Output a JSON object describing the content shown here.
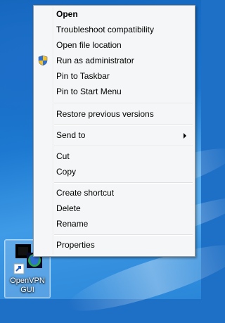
{
  "context_menu": {
    "items": [
      {
        "label": "Open"
      },
      {
        "label": "Troubleshoot compatibility"
      },
      {
        "label": "Open file location"
      },
      {
        "label": "Run as administrator",
        "icon": "uac-shield-icon"
      },
      {
        "label": "Pin to Taskbar"
      },
      {
        "label": "Pin to Start Menu"
      },
      {
        "label": "Restore previous versions"
      },
      {
        "label": "Send to",
        "icon": "submenu-arrow-icon"
      },
      {
        "label": "Cut"
      },
      {
        "label": "Copy"
      },
      {
        "label": "Create shortcut"
      },
      {
        "label": "Delete"
      },
      {
        "label": "Rename"
      },
      {
        "label": "Properties"
      }
    ]
  },
  "desktop_icon": {
    "label": "OpenVPN GUI",
    "icon": "openvpn-shortcut-icon"
  },
  "colors": {
    "menu_background": "#f5f6f7",
    "desktop_background": "#1e6fc6",
    "shield_blue": "#2f6fd0",
    "shield_yellow": "#f2c12e"
  }
}
